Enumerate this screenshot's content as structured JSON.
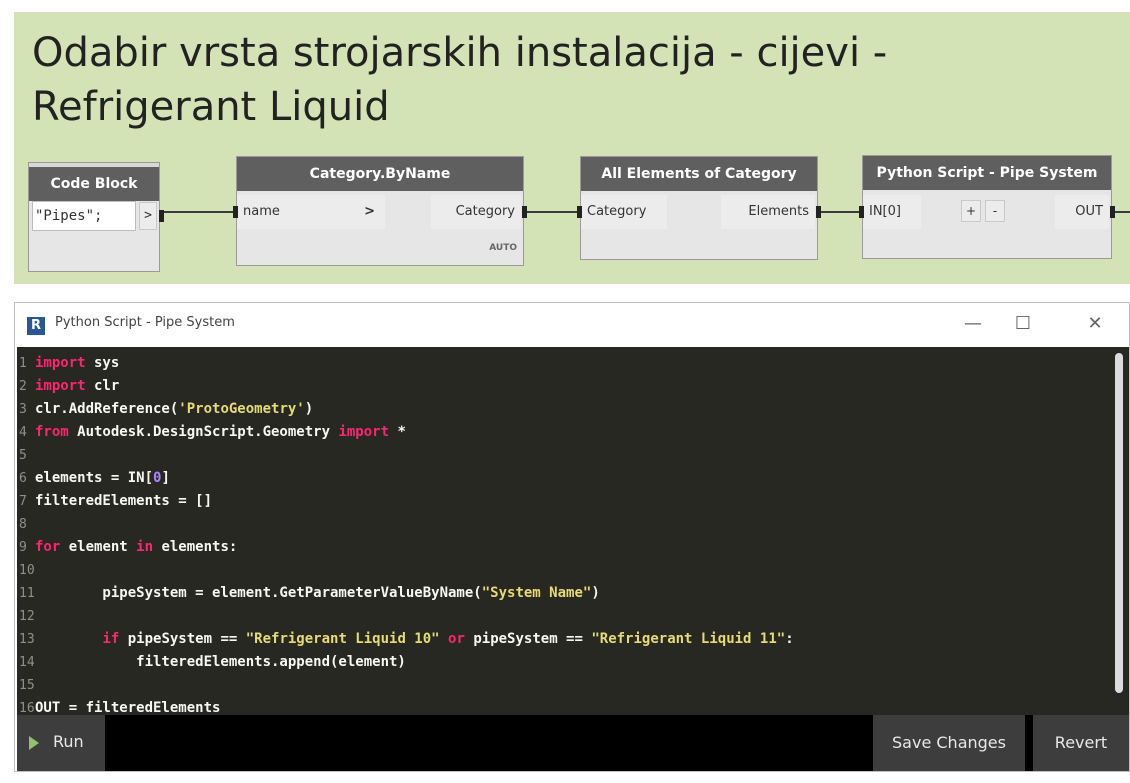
{
  "group": {
    "title": "Odabir vrsta strojarskih instalacija - cijevi - Refrigerant Liquid",
    "color": "#d4e3b5"
  },
  "nodes": {
    "code_block": {
      "title": "Code Block",
      "code": "\"Pipes\";",
      "output": ">"
    },
    "category_by_name": {
      "title": "Category.ByName",
      "input": "name",
      "input_arrow": ">",
      "output": "Category",
      "lacing": "AUTO"
    },
    "all_elements": {
      "title": "All Elements of Category",
      "input": "Category",
      "output": "Elements"
    },
    "python_script": {
      "title": "Python Script - Pipe System",
      "input": "IN[0]",
      "add": "+",
      "remove": "-",
      "output": "OUT"
    }
  },
  "editor_window": {
    "title": "Python Script - Pipe System",
    "app_icon": "R",
    "minimize_icon": "minimize-icon",
    "maximize_icon": "maximize-icon",
    "close_icon": "close-icon",
    "line_numbers": [
      "1",
      "2",
      "3",
      "4",
      "5",
      "6",
      "7",
      "8",
      "9",
      "10",
      "11",
      "12",
      "13",
      "14",
      "15",
      "16"
    ],
    "code": [
      "import sys",
      "import clr",
      "clr.AddReference('ProtoGeometry')",
      "from Autodesk.DesignScript.Geometry import *",
      "",
      "elements = IN[0]",
      "filteredElements = []",
      "",
      "for element in elements:",
      "",
      "        pipeSystem = element.GetParameterValueByName(\"System Name\")",
      "",
      "        if pipeSystem == \"Refrigerant Liquid 10\" or pipeSystem == \"Refrigerant Liquid 11\":",
      "            filteredElements.append(element)",
      "",
      "OUT = filteredElements"
    ],
    "run_label": "Run",
    "save_label": "Save Changes",
    "revert_label": "Revert"
  },
  "colors": {
    "keyword": "#f92672",
    "string": "#e6db74",
    "number": "#ae81ff",
    "editor_bg": "#272822",
    "node_header": "#5f5f5f"
  }
}
